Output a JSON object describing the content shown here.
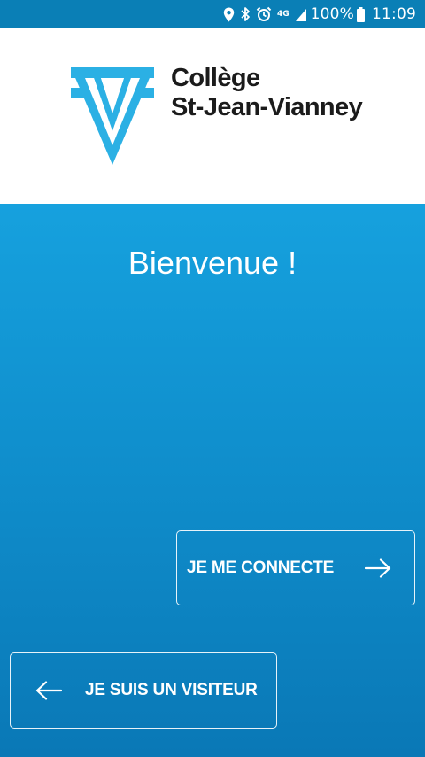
{
  "status_bar": {
    "network_label": "4G",
    "battery_text": "100%",
    "time": "11:09",
    "icons": [
      "location-icon",
      "bluetooth-icon",
      "alarm-icon",
      "signal-icon",
      "battery-icon"
    ]
  },
  "header": {
    "logo_line1": "Collège",
    "logo_line2": "St-Jean-Vianney",
    "logo_color": "#2bb0e4"
  },
  "main": {
    "welcome": "Bienvenue !",
    "connect_label": "JE ME CONNECTE",
    "visitor_label": "JE SUIS UN VISITEUR",
    "background_top": "#16a1de",
    "background_bottom": "#0a78b6"
  }
}
